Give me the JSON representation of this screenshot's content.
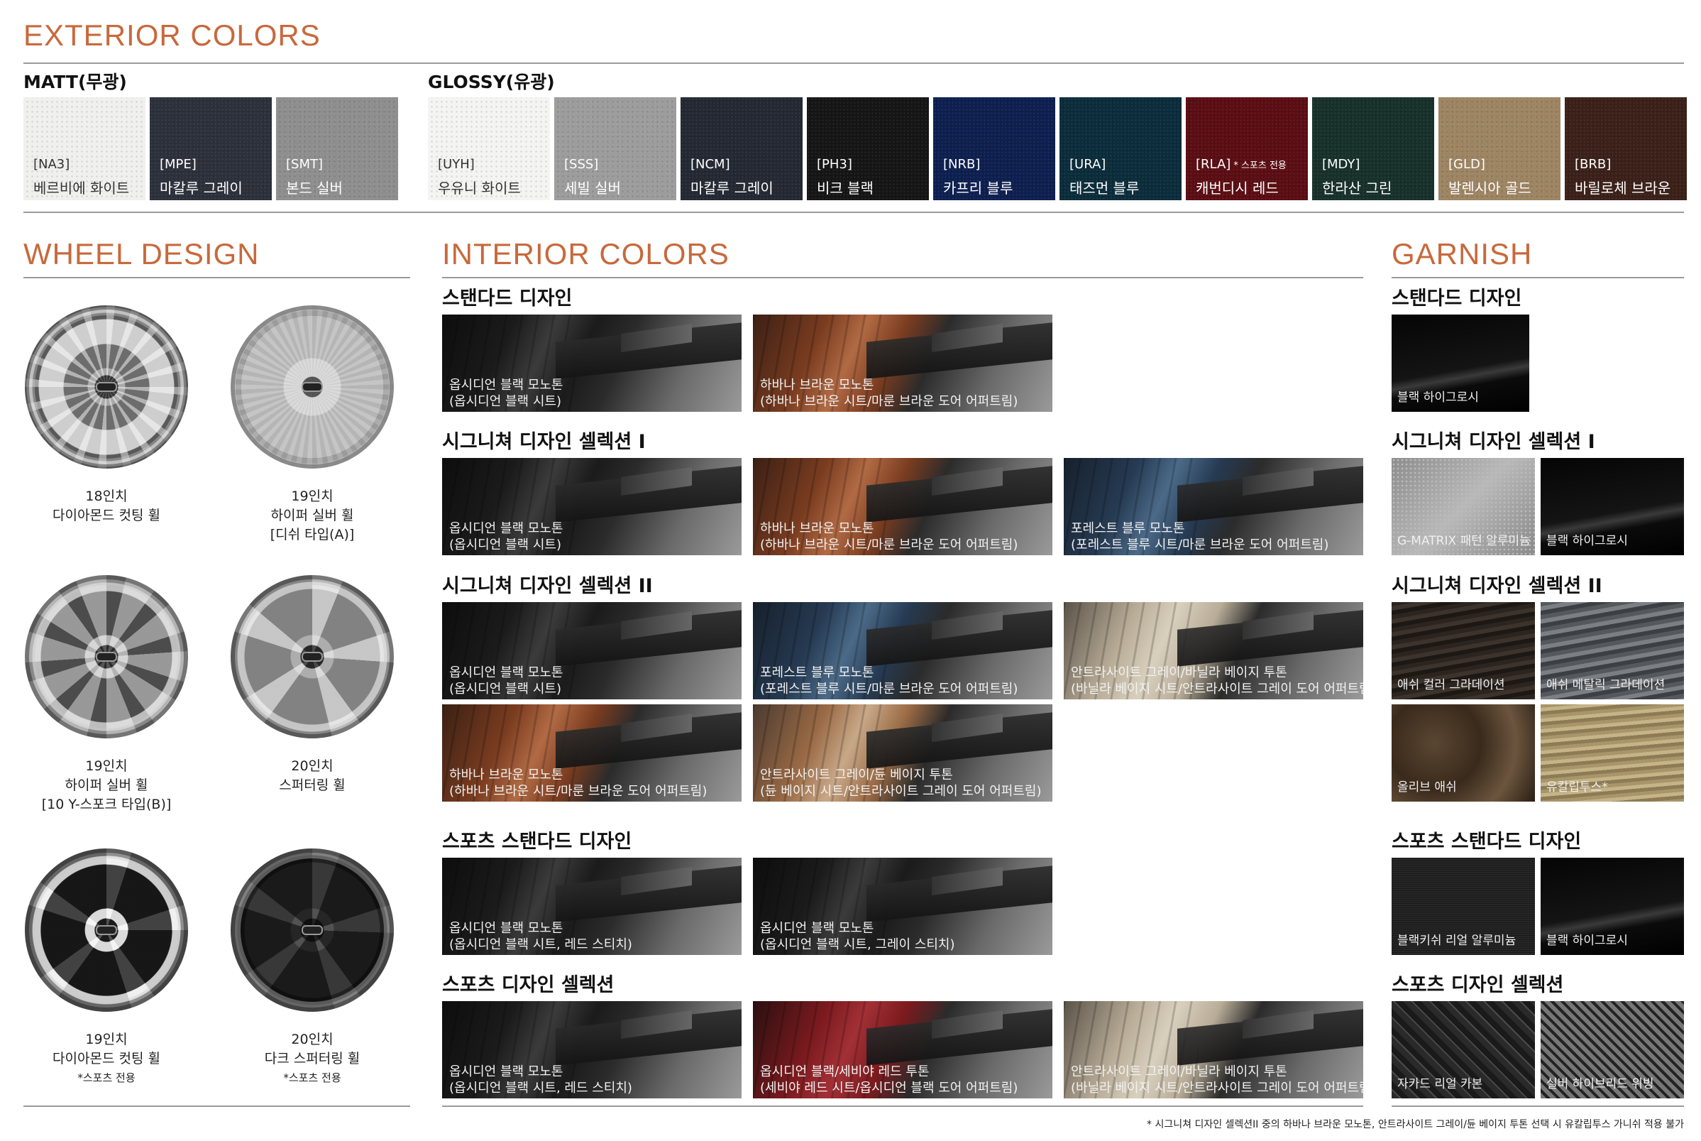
{
  "exterior": {
    "title": "EXTERIOR COLORS",
    "matt_label": "MATT(무광)",
    "glossy_label": "GLOSSY(유광)",
    "matt": [
      {
        "code": "[NA3]",
        "name": "베르비에 화이트",
        "color": "#f0f0ef"
      },
      {
        "code": "[MPE]",
        "name": "마칼루 그레이",
        "color": "#2b303a"
      },
      {
        "code": "[SMT]",
        "name": "본드 실버",
        "color": "#8e8e8e"
      }
    ],
    "glossy": [
      {
        "code": "[UYH]",
        "name": "우유니 화이트",
        "color": "#f4f4f3"
      },
      {
        "code": "[SSS]",
        "name": "세빌 실버",
        "color": "#9c9c9c"
      },
      {
        "code": "[NCM]",
        "name": "마칼루 그레이",
        "color": "#232832"
      },
      {
        "code": "[PH3]",
        "name": "비크 블랙",
        "color": "#151515"
      },
      {
        "code": "[NRB]",
        "name": "카프리 블루",
        "color": "#0d1f4f"
      },
      {
        "code": "[URA]",
        "name": "태즈먼 블루",
        "color": "#0b2c3a"
      },
      {
        "code": "[RLA]",
        "only": "* 스포츠 전용",
        "name": "캐번디시 레드",
        "color": "#5a0d12"
      },
      {
        "code": "[MDY]",
        "name": "한라산 그린",
        "color": "#17302a"
      },
      {
        "code": "[GLD]",
        "name": "발렌시아 골드",
        "color": "#9d8462"
      },
      {
        "code": "[BRB]",
        "name": "바릴로체 브라운",
        "color": "#3a2018"
      }
    ]
  },
  "wheel": {
    "title": "WHEEL DESIGN",
    "items": [
      {
        "size": "18인치",
        "name": "다이아몬드 컷팅 휠",
        "extra": ""
      },
      {
        "size": "19인치",
        "name": "하이퍼 실버 휠",
        "extra": "[디쉬 타입(A)]"
      },
      {
        "size": "19인치",
        "name": "하이퍼 실버 휠",
        "extra": "[10 Y-스포크 타입(B)]"
      },
      {
        "size": "20인치",
        "name": "스퍼터링 휠",
        "extra": ""
      },
      {
        "size": "19인치",
        "name": "다이아몬드 컷팅 휠",
        "extra": "*스포츠 전용"
      },
      {
        "size": "20인치",
        "name": "다크 스퍼터링 휠",
        "extra": "*스포츠 전용"
      }
    ]
  },
  "interior": {
    "title": "INTERIOR COLORS",
    "groups": [
      {
        "heading": "스탠다드 디자인",
        "items": [
          {
            "l1": "옵시디언 블랙 모노톤",
            "l2": "(옵시디언 블랙 시트)",
            "tone": "black"
          },
          {
            "l1": "하바나 브라운 모노톤",
            "l2": "(하바나 브라운 시트/마룬 브라운 도어 어퍼트림)",
            "tone": "brown"
          }
        ]
      },
      {
        "heading": "시그니쳐 디자인 셀렉션 I",
        "items": [
          {
            "l1": "옵시디언 블랙 모노톤",
            "l2": "(옵시디언 블랙 시트)",
            "tone": "black"
          },
          {
            "l1": "하바나 브라운 모노톤",
            "l2": "(하바나 브라운 시트/마룬 브라운 도어 어퍼트림)",
            "tone": "brown"
          },
          {
            "l1": "포레스트 블루 모노톤",
            "l2": "(포레스트 블루 시트/마룬 브라운 도어 어퍼트림)",
            "tone": "blue"
          }
        ]
      },
      {
        "heading": "시그니쳐 디자인 셀렉션 II",
        "items": [
          {
            "l1": "옵시디언 블랙 모노톤",
            "l2": "(옵시디언 블랙 시트)",
            "tone": "black"
          },
          {
            "l1": "포레스트 블루 모노톤",
            "l2": "(포레스트 블루 시트/마룬 브라운 도어 어퍼트림)",
            "tone": "blue"
          },
          {
            "l1": "안트라사이트 그레이/바닐라 베이지 투톤",
            "l2": "(바닐라 베이지 시트/안트라사이트 그레이 도어 어퍼트림)",
            "tone": "beige"
          },
          {
            "l1": "하바나 브라운 모노톤",
            "l2": "(하바나 브라운 시트/마룬 브라운 도어 어퍼트림)",
            "tone": "brown"
          },
          {
            "l1": "안트라사이트 그레이/듄 베이지 투톤",
            "l2": "(듄 베이지 시트/안트라사이트 그레이 도어 어퍼트림)",
            "tone": "dune"
          }
        ]
      },
      {
        "heading": "스포츠 스탠다드 디자인",
        "items": [
          {
            "l1": "옵시디언 블랙 모노톤",
            "l2": "(옵시디언 블랙 시트, 레드 스티치)",
            "tone": "black"
          },
          {
            "l1": "옵시디언 블랙 모노톤",
            "l2": "(옵시디언 블랙 시트, 그레이 스티치)",
            "tone": "black"
          }
        ]
      },
      {
        "heading": "스포츠 디자인 셀렉션",
        "items": [
          {
            "l1": "옵시디언 블랙 모노톤",
            "l2": "(옵시디언 블랙 시트, 레드 스티치)",
            "tone": "black"
          },
          {
            "l1": "옵시디언 블랙/세비야 레드 투톤",
            "l2": "(세비야 레드 시트/옵시디언 블랙 도어 어퍼트림)",
            "tone": "red"
          },
          {
            "l1": "안트라사이트 그레이/바닐라 베이지 투톤",
            "l2": "(바닐라 베이지 시트/안트라사이트 그레이 도어 어퍼트림)",
            "tone": "beige"
          }
        ]
      }
    ]
  },
  "garnish": {
    "title": "GARNISH",
    "groups": [
      {
        "heading": "스탠다드 디자인",
        "items": [
          {
            "label": "블랙 하이그로시",
            "tex": "gloss"
          }
        ]
      },
      {
        "heading": "시그니쳐 디자인 셀렉션 I",
        "items": [
          {
            "label": "G-MATRIX 패턴 알루미늄",
            "tex": "matrix"
          },
          {
            "label": "블랙 하이그로시",
            "tex": "gloss"
          }
        ]
      },
      {
        "heading": "시그니쳐 디자인 셀렉션 II",
        "items": [
          {
            "label": "애쉬 컬러 그라데이션",
            "tex": "ash"
          },
          {
            "label": "애쉬 메탈릭 그라데이션",
            "tex": "ashmetal"
          },
          {
            "label": "올리브 애쉬",
            "tex": "olive"
          },
          {
            "label": "유칼립투스*",
            "tex": "euca"
          }
        ]
      },
      {
        "heading": "스포츠 스탠다드 디자인",
        "items": [
          {
            "label": "블랙키쉬 리얼 알루미늄",
            "tex": "brushed"
          },
          {
            "label": "블랙 하이그로시",
            "tex": "gloss"
          }
        ]
      },
      {
        "heading": "스포츠 디자인 셀렉션",
        "items": [
          {
            "label": "자카드 리얼 카본",
            "tex": "carbon"
          },
          {
            "label": "실버 하이브리드 위빙",
            "tex": "weave"
          }
        ]
      }
    ]
  },
  "footnote": "* 시그니쳐 디자인 셀렉션II 중의 하바나 브라운 모노톤, 안트라사이트 그레이/듄 베이지 투톤 선택 시 유칼립투스 가니쉬 적용 불가"
}
